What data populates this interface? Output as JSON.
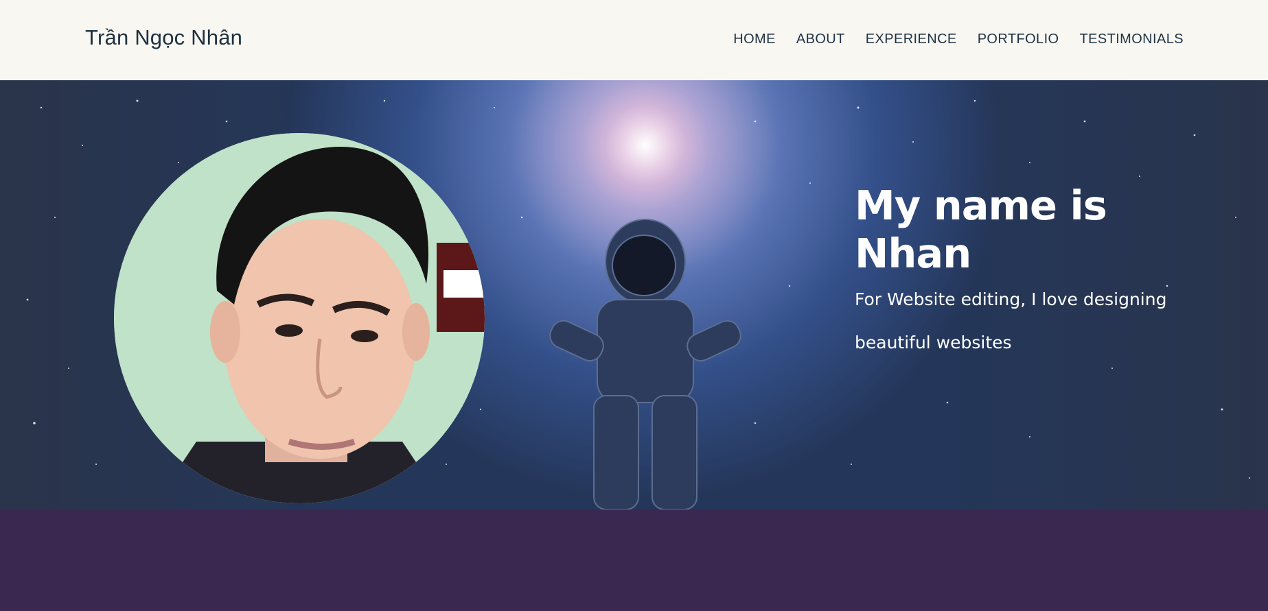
{
  "header": {
    "brand": "Trần Ngọc Nhân",
    "nav": [
      {
        "label": "HOME"
      },
      {
        "label": "ABOUT"
      },
      {
        "label": "EXPERIENCE"
      },
      {
        "label": "PORTFOLIO"
      },
      {
        "label": "TESTIMONIALS"
      }
    ]
  },
  "hero": {
    "title": "My name is Nhan",
    "subtitle": "For Website editing, I love designing beautiful websites"
  },
  "colors": {
    "header_bg": "#f8f7f2",
    "nav_text": "#1f3344",
    "hero_bg": "#2a3d62",
    "lower_bg": "#3a2850",
    "hero_text": "#ffffff"
  },
  "icons": {
    "background": "space-astronaut-image",
    "avatar": "profile-photo"
  }
}
